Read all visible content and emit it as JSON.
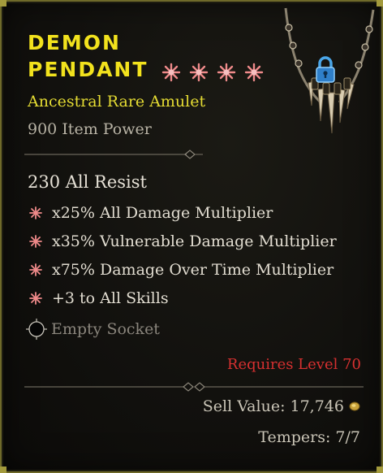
{
  "item": {
    "name_line1": "DEMON",
    "name_line2": "PENDANT",
    "type": "Ancestral Rare Amulet",
    "item_power": "900 Item Power"
  },
  "stats": {
    "implicit": "230 All Resist",
    "affixes": [
      "x25% All Damage Multiplier",
      "x35% Vulnerable Damage Multiplier",
      "x75% Damage Over Time Multiplier",
      "+3 to All Skills"
    ],
    "socket": "Empty Socket"
  },
  "footer": {
    "requires": "Requires Level 70",
    "sell_value": "Sell Value: 17,746",
    "tempers": "Tempers: 7/7"
  },
  "icons": [
    "masterwork-star-icon",
    "affix-bullet-icon",
    "socket-icon",
    "lock-icon",
    "gold-coin-icon",
    "amulet-icon"
  ],
  "colors": {
    "title": "#f2e21d",
    "rare": "#e5dc33",
    "requirement": "#d63030",
    "star": "#ef8a8a"
  }
}
